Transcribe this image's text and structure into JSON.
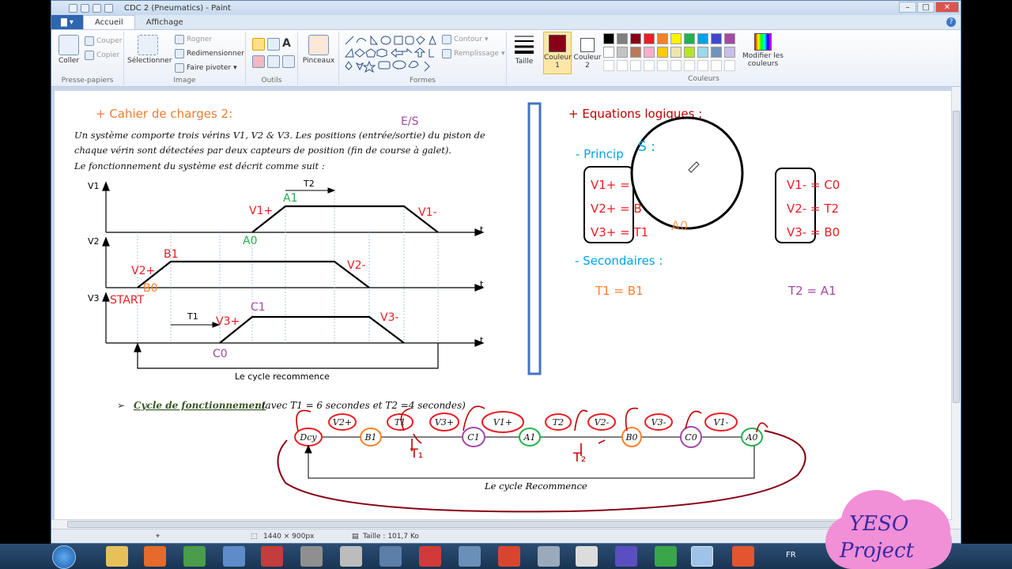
{
  "window": {
    "title": "CDC 2 (Pneumatics) - Paint",
    "controls": {
      "minimize": "–",
      "maximize": "□",
      "close": "✕"
    }
  },
  "tabs": {
    "file": "▇ ▾",
    "home": "Accueil",
    "view": "Affichage",
    "help": "?"
  },
  "ribbon": {
    "clipboard": {
      "label": "Presse-papiers",
      "paste": "Coller",
      "cut": "Couper",
      "copy": "Copier"
    },
    "image": {
      "label": "Image",
      "select": "Sélectionner",
      "crop": "Rogner",
      "resize": "Redimensionner",
      "rotate": "Faire pivoter"
    },
    "tools": {
      "label": "Outils"
    },
    "brushes": {
      "label": "Pinceaux"
    },
    "shapes": {
      "label": "Formes",
      "outline": "Contour",
      "fill": "Remplissage"
    },
    "size": {
      "label": "Taille"
    },
    "color1": {
      "label": "Couleur",
      "num": "1"
    },
    "color2": {
      "label": "Couleur",
      "num": "2"
    },
    "colors": {
      "label": "Couleurs",
      "edit": "Modifier les",
      "edit2": "couleurs"
    },
    "palette": [
      "#000000",
      "#7f7f7f",
      "#880015",
      "#ed1c24",
      "#ff7f27",
      "#fff200",
      "#22b14c",
      "#00a2e8",
      "#3f48cc",
      "#a349a4",
      "#ffffff",
      "#c3c3c3",
      "#b97a57",
      "#ffaec9",
      "#ffc90e",
      "#efe4b0",
      "#b5e61d",
      "#99d9ea",
      "#7092be",
      "#c8bfe7"
    ]
  },
  "status": {
    "dimensions": "1440 × 900px",
    "size": "Taille : 101,7 Ko"
  },
  "taskbar": {
    "lang": "FR"
  },
  "watermark": {
    "line1": "YESO",
    "line2": "Project"
  },
  "doc": {
    "title": "+ Cahier de charges 2:",
    "es": "E/S",
    "p1": "Un système comporte trois vérins V1, V2 & V3. Les positions (entrée/sortie) du piston de",
    "p2": "chaque vérin sont détectées par deux capteurs de position (fin de course à galet).",
    "p3": "Le fonctionnement du système est décrit comme suit :",
    "chart": {
      "v1": "V1",
      "v2": "V2",
      "v3": "V3",
      "t": "t",
      "t2": "T2",
      "t1": "T1",
      "a1": "A1",
      "v1p": "V1+",
      "v1m": "V1-",
      "a0": "A0",
      "b1": "B1",
      "v2p": "V2+",
      "v2m": "V2-",
      "b0": "B0",
      "start": "START",
      "c1": "C1",
      "v3p": "V3+",
      "v3m": "V3-",
      "c0": "C0",
      "restart": "Le cycle recommence"
    },
    "equations": {
      "title": "+ Equations logiques :",
      "primary": "- Princip",
      "s": "S :",
      "l1": "V1+ =",
      "l2": "V2+ = B",
      "l3": "V3+ = T1",
      "r1": "V1- = C0",
      "r2": "V2- = T2",
      "r3": "V3- = B0",
      "ao": "A0",
      "secondary": "- Secondaires :",
      "t1eq": "T1 = B1",
      "t2eq": "T2 = A1"
    },
    "cycle": {
      "bullet": "➢",
      "title": "Cycle de fonctionnement",
      "desc": ": (avec T1 = 6 secondes et T2 =4 secondes)",
      "dcy": "Dcy",
      "b1": "B1",
      "c1": "C1",
      "a1": "A1",
      "b0": "B0",
      "c0": "C0",
      "a0": "A0",
      "v2p": "V2+",
      "t1": "T1",
      "v3p": "V3+",
      "v1p": "V1+",
      "t2": "T2",
      "v2m": "V2-",
      "v3m": "V3-",
      "v1m": "V1-",
      "hw_t1": "T₁",
      "hw_t2": "T₂",
      "restart": "Le cycle Recommence"
    }
  }
}
